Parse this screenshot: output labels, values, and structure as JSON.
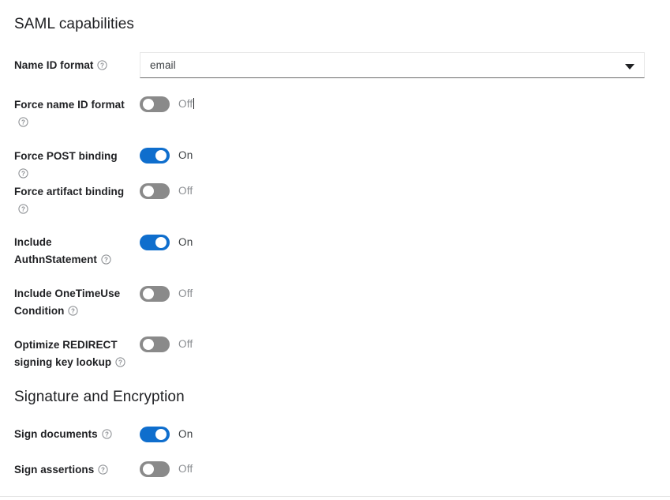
{
  "sections": [
    {
      "id": "saml",
      "title": "SAML capabilities"
    },
    {
      "id": "signature",
      "title": "Signature and Encryption"
    }
  ],
  "name_id_format": {
    "label": "Name ID format",
    "value": "email",
    "help_icon": "help-circle-icon",
    "arrow_icon": "chevron-down-icon"
  },
  "toggles": [
    {
      "label": "Force name ID format",
      "state": "Off",
      "on": false,
      "help_icon": "help-circle-icon",
      "has_caret": true
    },
    {
      "label": "Force POST binding",
      "state": "On",
      "on": true,
      "help_icon": "help-circle-icon",
      "has_caret": false
    },
    {
      "label": "Force artifact binding",
      "state": "Off",
      "on": false,
      "help_icon": "help-circle-icon",
      "has_caret": false
    },
    {
      "label": "Include AuthnStatement",
      "state": "On",
      "on": true,
      "help_icon": "help-circle-icon",
      "has_caret": false
    },
    {
      "label": "Include OneTimeUse Condition",
      "state": "Off",
      "on": false,
      "help_icon": "help-circle-icon",
      "has_caret": false
    },
    {
      "label": "Optimize REDIRECT signing key lookup",
      "state": "Off",
      "on": false,
      "help_icon": "help-circle-icon",
      "has_caret": false
    },
    {
      "label": "Sign documents",
      "state": "On",
      "on": true,
      "help_icon": "help-circle-icon",
      "has_caret": false
    },
    {
      "label": "Sign assertions",
      "state": "Off",
      "on": false,
      "help_icon": "help-circle-icon",
      "has_caret": false
    }
  ],
  "colors": {
    "toggle_on": "#0f6ecd",
    "toggle_off": "#8a8a8a",
    "label": "#202124",
    "state_on_text": "#3c4043",
    "state_off_text": "#8a8d91",
    "divider": "#e4e4e4"
  }
}
